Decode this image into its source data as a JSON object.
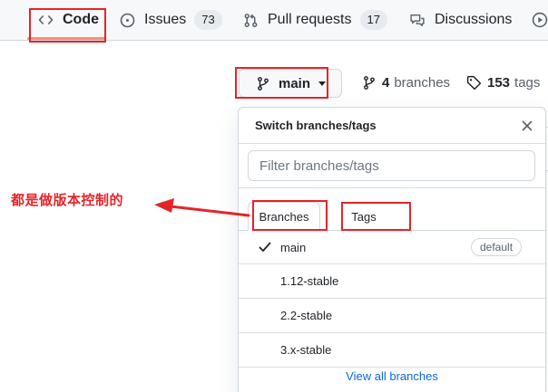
{
  "nav": {
    "code": "Code",
    "issues": "Issues",
    "issues_count": "73",
    "pulls": "Pull requests",
    "pulls_count": "17",
    "discussions": "Discussions"
  },
  "branch_button": {
    "label": "main",
    "icon": "git-branch-icon"
  },
  "meta": {
    "branches_count": "4",
    "branches_label": "branches",
    "tags_count": "153",
    "tags_label": "tags"
  },
  "dropdown": {
    "title": "Switch branches/tags",
    "filter_placeholder": "Filter branches/tags",
    "tabs": [
      "Branches",
      "Tags"
    ],
    "items": [
      {
        "label": "main",
        "selected": true,
        "badge": "default"
      },
      {
        "label": "1.12-stable"
      },
      {
        "label": "2.2-stable"
      },
      {
        "label": "3.x-stable"
      }
    ],
    "footer_link": "View all branches"
  },
  "annotation": {
    "text": "都是做版本控制的",
    "color": "#e5242a"
  },
  "colors": {
    "accent": "#fd8c73",
    "link": "#0969da",
    "annotation": "#e5242a"
  }
}
